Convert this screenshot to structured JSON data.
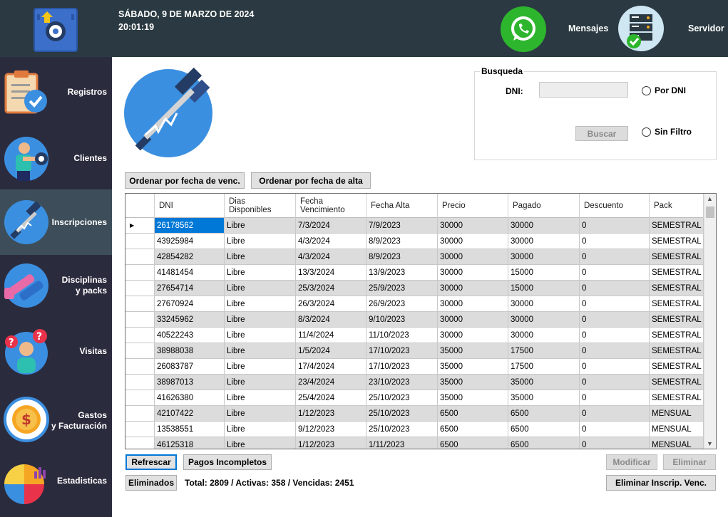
{
  "header": {
    "date": "SÁBADO, 9 DE MARZO DE 2024",
    "time": "20:01:19",
    "mensajes_label": "Mensajes",
    "servidor_label": "Servidor"
  },
  "sidebar": {
    "items": [
      {
        "label": "Registros"
      },
      {
        "label": "Clientes"
      },
      {
        "label": "Inscripciones"
      },
      {
        "label": "Disciplinas\ny packs"
      },
      {
        "label": "Visitas"
      },
      {
        "label": "Gastos\ny Facturación"
      },
      {
        "label": "Estadisticas"
      }
    ]
  },
  "search": {
    "legend": "Busqueda",
    "dni_label": "DNI:",
    "dni_value": "",
    "buscar_label": "Buscar",
    "radio_dni": "Por DNI",
    "radio_sin_filtro": "Sin Filtro"
  },
  "sort": {
    "venc_label": "Ordenar por fecha de venc.",
    "alta_label": "Ordenar por fecha de alta"
  },
  "table": {
    "headers": [
      "DNI",
      "Dias\nDisponibles",
      "Fecha\nVencimiento",
      "Fecha Alta",
      "Precio",
      "Pagado",
      "Descuento",
      "Pack"
    ],
    "rows": [
      [
        "26178562",
        "Libre",
        "7/3/2024",
        "7/9/2023",
        "30000",
        "30000",
        "0",
        "SEMESTRAL"
      ],
      [
        "43925984",
        "Libre",
        "4/3/2024",
        "8/9/2023",
        "30000",
        "30000",
        "0",
        "SEMESTRAL"
      ],
      [
        "42854282",
        "Libre",
        "4/3/2024",
        "8/9/2023",
        "30000",
        "30000",
        "0",
        "SEMESTRAL"
      ],
      [
        "41481454",
        "Libre",
        "13/3/2024",
        "13/9/2023",
        "30000",
        "15000",
        "0",
        "SEMESTRAL"
      ],
      [
        "27654714",
        "Libre",
        "25/3/2024",
        "25/9/2023",
        "30000",
        "15000",
        "0",
        "SEMESTRAL"
      ],
      [
        "27670924",
        "Libre",
        "26/3/2024",
        "26/9/2023",
        "30000",
        "30000",
        "0",
        "SEMESTRAL"
      ],
      [
        "33245962",
        "Libre",
        "8/3/2024",
        "9/10/2023",
        "30000",
        "30000",
        "0",
        "SEMESTRAL"
      ],
      [
        "40522243",
        "Libre",
        "11/4/2024",
        "11/10/2023",
        "30000",
        "30000",
        "0",
        "SEMESTRAL"
      ],
      [
        "38988038",
        "Libre",
        "1/5/2024",
        "17/10/2023",
        "35000",
        "17500",
        "0",
        "SEMESTRAL"
      ],
      [
        "26083787",
        "Libre",
        "17/4/2024",
        "17/10/2023",
        "35000",
        "17500",
        "0",
        "SEMESTRAL"
      ],
      [
        "38987013",
        "Libre",
        "23/4/2024",
        "23/10/2023",
        "35000",
        "35000",
        "0",
        "SEMESTRAL"
      ],
      [
        "41626380",
        "Libre",
        "25/4/2024",
        "25/10/2023",
        "35000",
        "35000",
        "0",
        "SEMESTRAL"
      ],
      [
        "42107422",
        "Libre",
        "1/12/2023",
        "25/10/2023",
        "6500",
        "6500",
        "0",
        "MENSUAL"
      ],
      [
        "13538551",
        "Libre",
        "9/12/2023",
        "25/10/2023",
        "6500",
        "6500",
        "0",
        "MENSUAL"
      ],
      [
        "46125318",
        "Libre",
        "1/12/2023",
        "1/11/2023",
        "6500",
        "6500",
        "0",
        "MENSUAL"
      ]
    ]
  },
  "actions": {
    "refrescar": "Refrescar",
    "pagos_incompletos": "Pagos Incompletos",
    "modificar": "Modificar",
    "eliminar": "Eliminar",
    "eliminados": "Eliminados",
    "eliminar_venc": "Eliminar Inscrip. Venc.",
    "totals": "Total: 2809 / Activas: 358 / Vencidas: 2451"
  }
}
